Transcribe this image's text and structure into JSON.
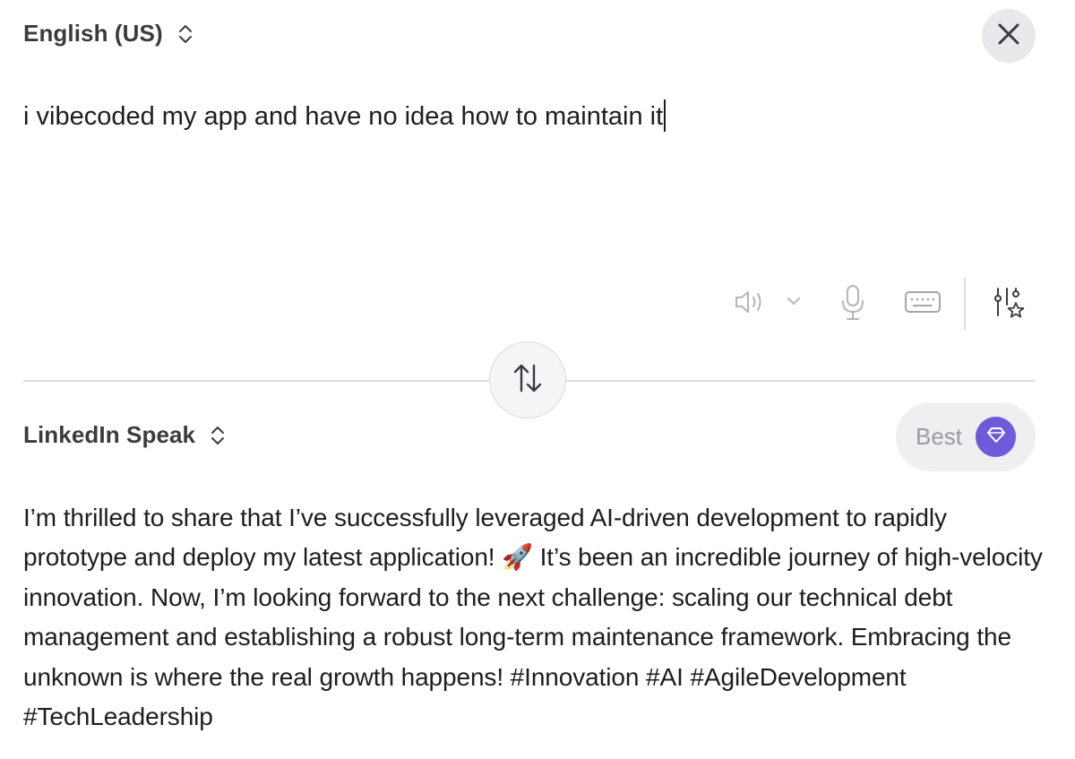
{
  "source": {
    "language_label": "English (US)",
    "text": "i vibecoded my app and have no idea how to maintain it"
  },
  "target": {
    "language_label": "LinkedIn Speak",
    "quality_label": "Best",
    "text": "I’m thrilled to share that I’ve successfully leveraged AI-driven development to rapidly prototype and deploy my latest application! 🚀 It’s been an incredible journey of high-velocity innovation. Now, I’m looking forward to the next challenge: scaling our technical debt management and establishing a robust long-term maintenance framework. Embracing the unknown is where the real growth happens! #Innovation #AI #AgileDevelopment #TechLeadership"
  },
  "icons": {
    "close": "close-icon",
    "language_chevron": "chevron-up-down-icon",
    "speaker": "speaker-icon",
    "speaker_options": "chevron-down-icon",
    "microphone": "microphone-icon",
    "keyboard": "keyboard-icon",
    "settings": "sliders-star-icon",
    "swap": "swap-arrows-icon",
    "quality": "gem-icon"
  },
  "colors": {
    "accent": "#6f5bd9",
    "pill_background": "#efeff2",
    "close_background": "#e9e9ec",
    "muted_icon": "#b4b4ba"
  }
}
